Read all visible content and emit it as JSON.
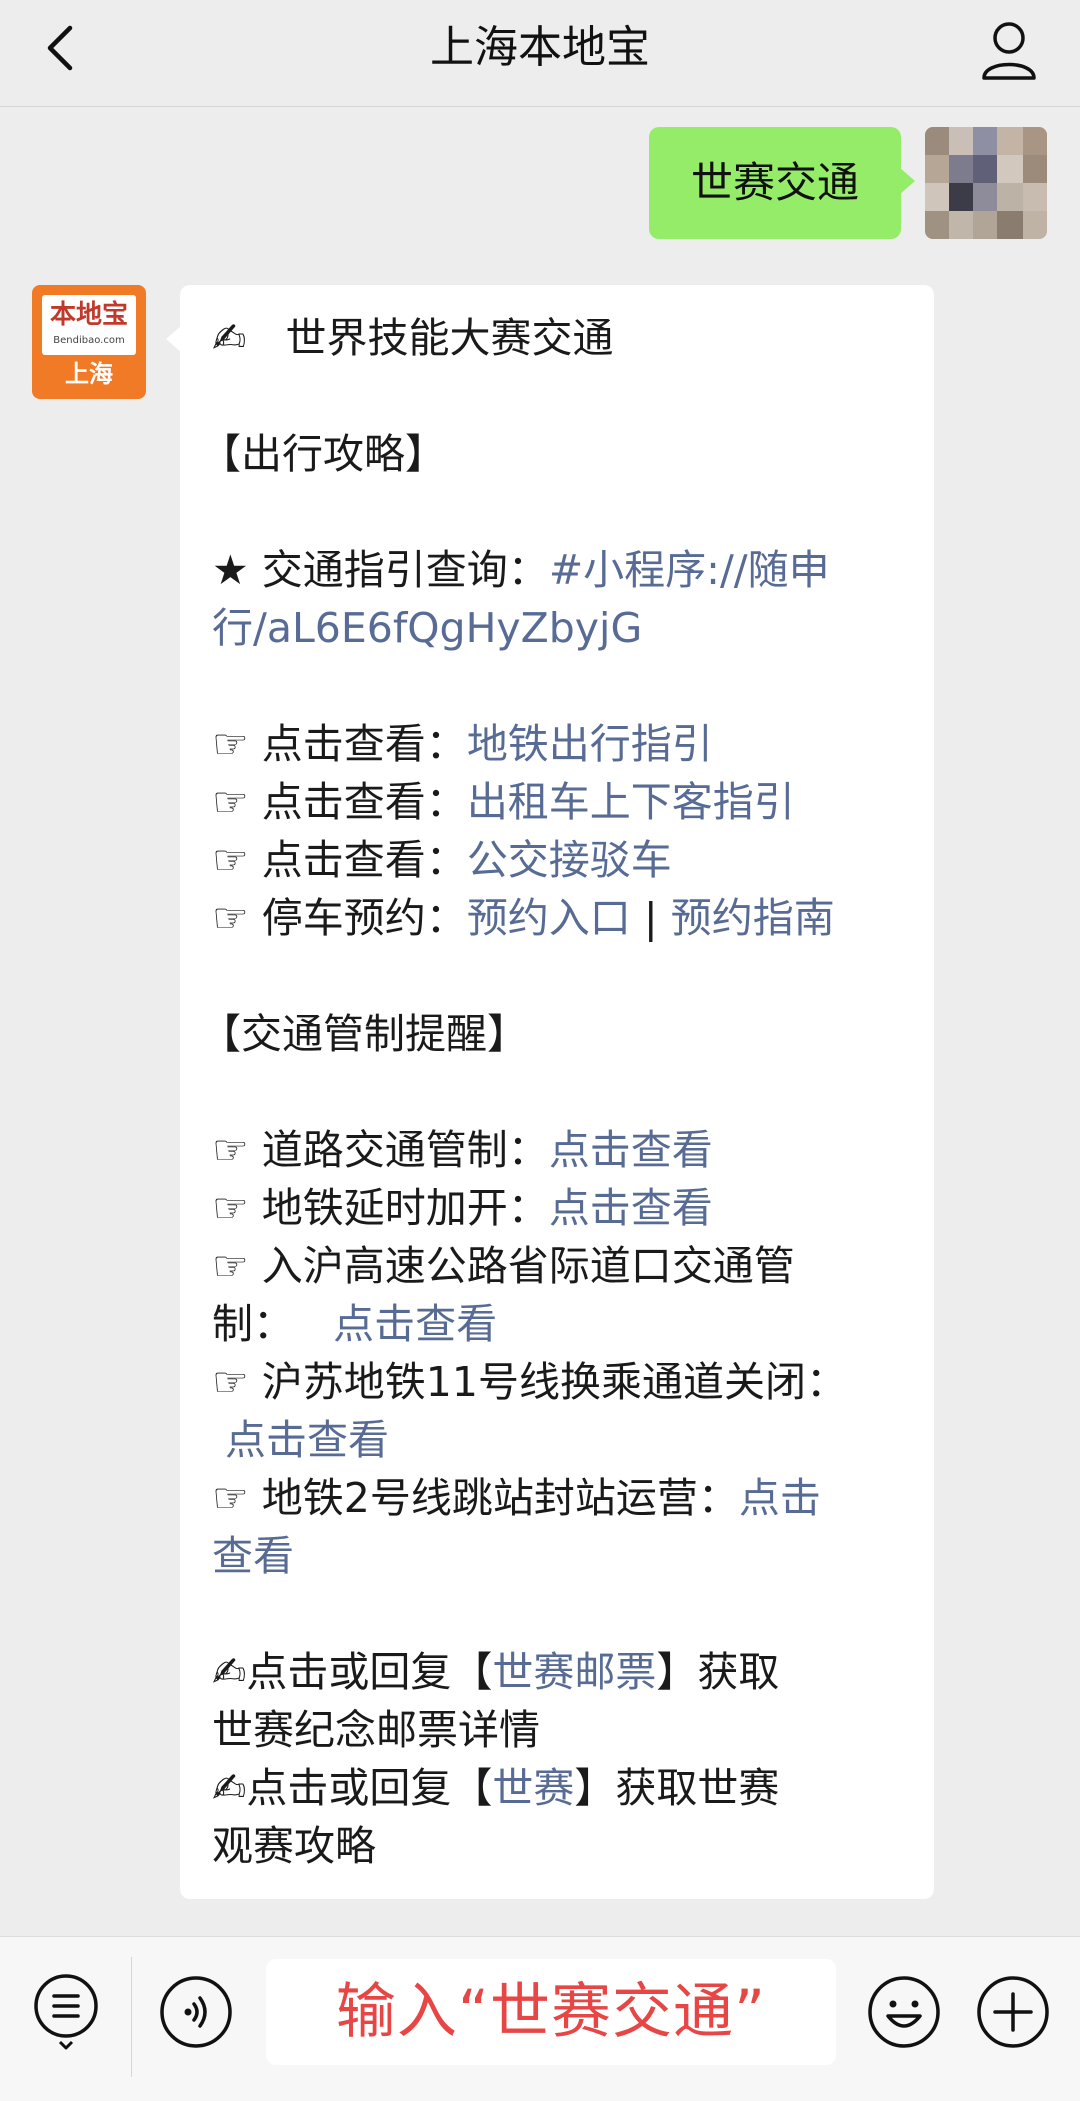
{
  "header": {
    "title": "上海本地宝"
  },
  "outgoing": {
    "text": "世赛交通"
  },
  "bot_avatar": {
    "logo_cn": "本地宝",
    "logo_en": "Bendibao.com",
    "logo_city": "上海"
  },
  "message": {
    "headline_emoji": "✍",
    "headline": "世界技能大赛交通",
    "section1": "【出行攻略】",
    "guide_star": "★",
    "guide_label": " 交通指引查询：",
    "guide_link_1": "#小程序://随申",
    "guide_link_2": "行/aL6E6fQgHyZbyjG",
    "hand": "☞",
    "items1": [
      {
        "label": " 点击查看：",
        "link": "地铁出行指引"
      },
      {
        "label": " 点击查看：",
        "link": "出租车上下客指引"
      },
      {
        "label": " 点击查看：",
        "link": "公交接驳车"
      }
    ],
    "parking_label": " 停车预约：",
    "parking_link1": "预约入口",
    "parking_sep": " | ",
    "parking_link2": "预约指南",
    "section2": "【交通管制提醒】",
    "ctl1_label": " 道路交通管制：",
    "ctl1_link": "点击查看",
    "ctl2_label": " 地铁延时加开：",
    "ctl2_link": "点击查看",
    "ctl3_label1": " 入沪高速公路省际道口交通管",
    "ctl3_label2": "制：",
    "ctl3_link": "点击查看",
    "ctl4_label": " 沪苏地铁11号线换乘通道关闭：",
    "ctl4_link": "点击查看",
    "ctl5_label": " 地铁2号线跳站封站运营：",
    "ctl5_link1": "点击",
    "ctl5_link2": "查看",
    "reply1_pre": "点击或回复【",
    "reply1_link": "世赛邮票",
    "reply1_post": "】获取",
    "reply1_line2": "世赛纪念邮票详情",
    "reply2_pre": "点击或回复【",
    "reply2_link": "世赛",
    "reply2_post": "】获取世赛",
    "reply2_line2": "观赛攻略"
  },
  "input": {
    "value": "输入“世赛交通”"
  },
  "icons": {
    "back": "chevron-left-icon",
    "profile": "person-icon",
    "menu": "list-menu-icon",
    "voice": "voice-icon",
    "emoji": "smiley-icon",
    "plus": "plus-icon"
  },
  "colors": {
    "background": "#ededed",
    "outgoing_bubble": "#95ec69",
    "link": "#576b95",
    "input_text": "#e84545",
    "avatar_orange": "#f07a25"
  }
}
